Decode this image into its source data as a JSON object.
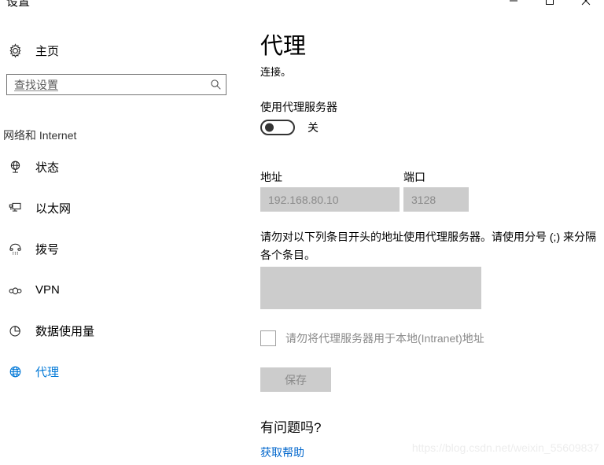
{
  "window": {
    "title": "设置",
    "controls": [
      {
        "name": "minimize",
        "icon": "minimize-icon"
      },
      {
        "name": "maximize",
        "icon": "maximize-icon"
      },
      {
        "name": "close",
        "icon": "close-icon"
      }
    ]
  },
  "sidebar": {
    "home": {
      "label": "主页",
      "icon": "gear-icon"
    },
    "search": {
      "placeholder": "查找设置",
      "value": "",
      "icon": "search-icon"
    },
    "section_header": "网络和 Internet",
    "items": [
      {
        "label": "状态",
        "icon": "globe-status-icon",
        "selected": false
      },
      {
        "label": "以太网",
        "icon": "ethernet-monitor-icon",
        "selected": false
      },
      {
        "label": "拨号",
        "icon": "dialup-phone-icon",
        "selected": false
      },
      {
        "label": "VPN",
        "icon": "vpn-icon",
        "selected": false
      },
      {
        "label": "数据使用量",
        "icon": "data-usage-pie-icon",
        "selected": false
      },
      {
        "label": "代理",
        "icon": "proxy-globe-icon",
        "selected": true
      }
    ]
  },
  "main": {
    "title": "代理",
    "subtitle": "连接。",
    "use_proxy_label": "使用代理服务器",
    "toggle_state": "关",
    "toggle_on": false,
    "address_label": "地址",
    "address_value": "192.168.80.10",
    "port_label": "端口",
    "port_value": "3128",
    "exception_description": "请勿对以下列条目开头的地址使用代理服务器。请使用分号 (;) 来分隔各个条目。",
    "exception_value": "",
    "bypass_local_label": "请勿将代理服务器用于本地(Intranet)地址",
    "bypass_local_checked": false,
    "save_label": "保存",
    "help_title": "有问题吗?",
    "help_link": "获取帮助"
  },
  "watermark": "https://blog.csdn.net/weixin_55609837",
  "colors": {
    "accent": "#0078d7",
    "link": "#0066cc",
    "disabled_field": "#cccccc",
    "disabled_text": "#8a8a8a"
  }
}
